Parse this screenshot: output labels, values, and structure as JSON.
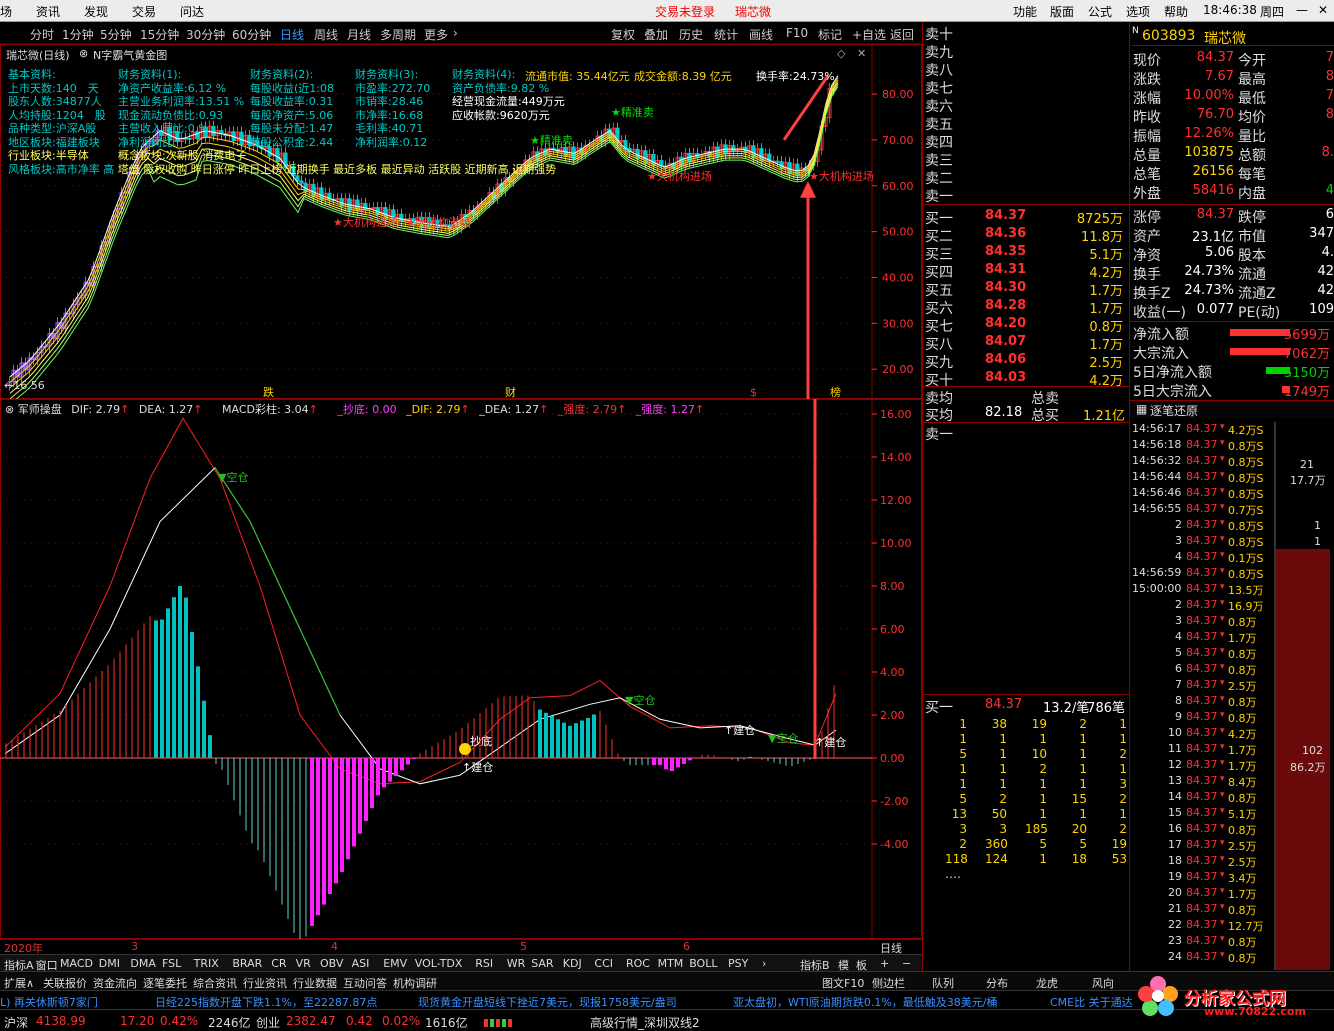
{
  "menubar": {
    "items": [
      "场",
      "资讯",
      "发现",
      "交易",
      "问达"
    ],
    "center_left": "交易未登录",
    "center_right": "瑞芯微",
    "right_items": [
      "功能",
      "版面",
      "公式",
      "选项",
      "帮助"
    ],
    "time": "18:46:38",
    "weekday": "周四"
  },
  "toolbar": {
    "periods": [
      "分时",
      "1分钟",
      "5分钟",
      "15分钟",
      "30分钟",
      "60分钟",
      "日线",
      "周线",
      "月线",
      "多周期",
      "更多"
    ],
    "active": "日线",
    "tools": [
      "复权",
      "叠加",
      "历史",
      "统计",
      "画线",
      "F10",
      "标记",
      "+自选",
      "返回"
    ]
  },
  "kchart": {
    "title": "瑞芯微(日线)",
    "formula": "N字霸气黄金图",
    "y_ticks": [
      "80.00",
      "70.00",
      "60.00",
      "50.00",
      "40.00",
      "30.00",
      "20.00"
    ],
    "low_mark": "16.56",
    "info": {
      "col1": [
        "基本资料:",
        "上市天数:140　天",
        "股东人数:34877人",
        "人均持股:1204　股",
        "品种类型:沪深A股",
        "地区板块:福建板块",
        "行业板块:半导体",
        "风格板块:高市净率 高"
      ],
      "col2": [
        "财务资料(1):",
        "净资产收益率:6.12 %",
        "主营业务利润率:13.51 %",
        "现金流动负债比:0.93",
        "主营收入同比:0.%",
        "净利润同比:",
        "概念板块:次新股 消费电子"
      ],
      "col3": [
        "财务资料(2):",
        "每股收益(近1:08",
        "每股收益率:0.31",
        "每股净资产:5.06",
        "每股未分配:1.47",
        "每股公积金:2.44"
      ],
      "col4": [
        "财务资料(3):",
        "市盈率:272.70",
        "市销率:28.46",
        "市净率:16.68",
        "毛利率:40.71",
        "净利润率:0.12"
      ],
      "col5": [
        "财务资料(4):",
        "资产负债率:9.82 %",
        "经营现金流量:449万元",
        "应收帐款:9620万元"
      ],
      "market_value": "流通市值: 35.44亿元",
      "turnover_amt": "成交金额:8.39 亿元",
      "turnover_rate": "换手率:24.73%",
      "style_tail": "塔值 股权收购 昨日涨停 昨日上榜 近期换手 最近多板 最近异动 活跃股 近期新高 近期强势"
    },
    "labels": {
      "accurate_sell": "精准卖",
      "accurate_sell2": "精准卖",
      "inst1": "大机构进场",
      "inst2": "大机构进场",
      "inst3": "大机构进场",
      "inst4": "大机构进场"
    },
    "events": [
      "跌",
      "财",
      "$",
      "榜"
    ]
  },
  "macd": {
    "title": "军师操盘",
    "dif": "DIF: 2.79",
    "dea": "DEA: 1.27",
    "bar": "MACD彩柱: 3.04",
    "chaodi": "_抄底: 0.00",
    "dif2": "_DIF: 2.79",
    "dea2": "_DEA: 1.27",
    "strong": "_强度: 2.79",
    "strong2": "_强度: 1.27",
    "y_ticks": [
      "16.00",
      "14.00",
      "12.00",
      "10.00",
      "8.00",
      "6.00",
      "4.00",
      "2.00",
      "0.00",
      "-2.00",
      "-4.00"
    ],
    "labels": {
      "kongcang": "空仓",
      "chaodi": "抄底",
      "jiancang": "建仓"
    }
  },
  "dates": [
    "2020年",
    "3",
    "4",
    "5",
    "6"
  ],
  "indicator_tabs": [
    "指标A",
    "窗口",
    "MACD",
    "DMI",
    "DMA",
    "FSL",
    "TRIX",
    "BRAR",
    "CR",
    "VR",
    "OBV",
    "ASI",
    "EMV",
    "VOL-TDX",
    "RSI",
    "WR",
    "SAR",
    "KDJ",
    "CCI",
    "ROC",
    "MTM",
    "BOLL",
    "PSY"
  ],
  "indicator_right": [
    "指标B",
    "模",
    "板"
  ],
  "bottom_tabs": [
    "扩展∧",
    "关联报价",
    "资金流向",
    "逐笔委托",
    "综合资讯",
    "行业资讯",
    "行业数据",
    "互动问答",
    "机构调研"
  ],
  "bottom_right": [
    "图文F10",
    "侧边栏",
    "队列",
    "分布",
    "龙虎",
    "板块",
    "风向"
  ],
  "orderbook": {
    "sell_labels": [
      "卖十",
      "卖九",
      "卖八",
      "卖七",
      "卖六",
      "卖五",
      "卖四",
      "卖三",
      "卖二",
      "卖一"
    ],
    "buys": [
      [
        "买一",
        "84.37",
        "8725万"
      ],
      [
        "买二",
        "84.36",
        "11.8万"
      ],
      [
        "买三",
        "84.35",
        "5.1万"
      ],
      [
        "买四",
        "84.31",
        "4.2万"
      ],
      [
        "买五",
        "84.30",
        "1.7万"
      ],
      [
        "买六",
        "84.28",
        "1.7万"
      ],
      [
        "买七",
        "84.20",
        "0.8万"
      ],
      [
        "买八",
        "84.07",
        "1.7万"
      ],
      [
        "买九",
        "84.06",
        "2.5万"
      ],
      [
        "买十",
        "84.03",
        "4.2万"
      ]
    ],
    "avg_sell": "卖均",
    "avg_buy": "买均",
    "avg_buy_price": "82.18",
    "total_sell": "总卖",
    "total_buy": "总买",
    "total_buy_val": "1.21亿",
    "sell1": "卖一",
    "queue_head": [
      "买一",
      "84.37",
      "13.2/笔",
      "786笔"
    ],
    "queue": [
      [
        "1",
        "38",
        "19",
        "2",
        "1"
      ],
      [
        "1",
        "1",
        "1",
        "1",
        "1"
      ],
      [
        "5",
        "1",
        "10",
        "1",
        "2"
      ],
      [
        "1",
        "1",
        "2",
        "1",
        "1"
      ],
      [
        "1",
        "1",
        "1",
        "1",
        "3"
      ],
      [
        "5",
        "2",
        "1",
        "15",
        "2"
      ],
      [
        "13",
        "50",
        "1",
        "1",
        "1"
      ],
      [
        "3",
        "3",
        "185",
        "20",
        "2"
      ],
      [
        "2",
        "360",
        "5",
        "5",
        "19"
      ],
      [
        "118",
        "124",
        "1",
        "18",
        "53"
      ]
    ],
    "more": "…."
  },
  "quote": {
    "code": "603893",
    "name": "瑞芯微",
    "rows": [
      [
        "现价",
        "84.37",
        "今开",
        "7"
      ],
      [
        "涨跌",
        "7.67",
        "最高",
        "8"
      ],
      [
        "涨幅",
        "10.00%",
        "最低",
        "7"
      ],
      [
        "昨收",
        "76.70",
        "均价",
        "8"
      ],
      [
        "振幅",
        "12.26%",
        "量比",
        ""
      ],
      [
        "总量",
        "103875",
        "总额",
        "8."
      ],
      [
        "总笔",
        "26156",
        "每笔",
        ""
      ],
      [
        "外盘",
        "58416",
        "内盘",
        "4"
      ]
    ],
    "rows2": [
      [
        "涨停",
        "84.37",
        "跌停",
        "6"
      ],
      [
        "资产",
        "23.1亿",
        "市值",
        "347"
      ],
      [
        "净资",
        "5.06",
        "股本",
        "4."
      ],
      [
        "换手",
        "24.73%",
        "流通",
        "42"
      ],
      [
        "换手Z",
        "24.73%",
        "流通Z",
        "42"
      ],
      [
        "收益(一)",
        "0.077",
        "PE(动)",
        "109"
      ]
    ],
    "flows": [
      [
        "净流入额",
        "5699万"
      ],
      [
        "大宗流入",
        "7062万"
      ],
      [
        "5日净流入额",
        "-5150万"
      ],
      [
        "5日大宗流入",
        "1749万"
      ]
    ]
  },
  "ticks": {
    "title": "逐笔还原",
    "rows": [
      [
        "14:56:17",
        "84.37",
        "4.2万S"
      ],
      [
        "14:56:18",
        "84.37",
        "0.8万S"
      ],
      [
        "14:56:32",
        "84.37",
        "0.8万S"
      ],
      [
        "14:56:44",
        "84.37",
        "0.8万S"
      ],
      [
        "14:56:46",
        "84.37",
        "0.8万S"
      ],
      [
        "14:56:55",
        "84.37",
        "0.7万S"
      ],
      [
        "2",
        "84.37",
        "0.8万S"
      ],
      [
        "3",
        "84.37",
        "0.8万S"
      ],
      [
        "4",
        "84.37",
        "0.1万S"
      ],
      [
        "14:56:59",
        "84.37",
        "0.8万S"
      ],
      [
        "15:00:00",
        "84.37",
        "13.5万"
      ],
      [
        "2",
        "84.37",
        "16.9万"
      ],
      [
        "3",
        "84.37",
        "0.8万"
      ],
      [
        "4",
        "84.37",
        "1.7万"
      ],
      [
        "5",
        "84.37",
        "0.8万"
      ],
      [
        "6",
        "84.37",
        "0.8万"
      ],
      [
        "7",
        "84.37",
        "2.5万"
      ],
      [
        "8",
        "84.37",
        "0.8万"
      ],
      [
        "9",
        "84.37",
        "0.8万"
      ],
      [
        "10",
        "84.37",
        "4.2万"
      ],
      [
        "11",
        "84.37",
        "1.7万"
      ],
      [
        "12",
        "84.37",
        "1.7万"
      ],
      [
        "13",
        "84.37",
        "8.4万"
      ],
      [
        "14",
        "84.37",
        "0.8万"
      ],
      [
        "15",
        "84.37",
        "5.1万"
      ],
      [
        "16",
        "84.37",
        "0.8万"
      ],
      [
        "17",
        "84.37",
        "2.5万"
      ],
      [
        "18",
        "84.37",
        "2.5万"
      ],
      [
        "19",
        "84.37",
        "3.4万"
      ],
      [
        "20",
        "84.37",
        "1.7万"
      ],
      [
        "21",
        "84.37",
        "0.8万"
      ],
      [
        "22",
        "84.37",
        "12.7万"
      ],
      [
        "23",
        "84.37",
        "0.8万"
      ],
      [
        "24",
        "84.37",
        "0.8万"
      ]
    ],
    "side": [
      "21",
      "17.7万",
      "1",
      "1",
      "102",
      "86.2万"
    ]
  },
  "ticker": {
    "items": [
      "L) 再关休斯顿7家门",
      "日经225指数开盘下跌1.1%，至22287.87点",
      "现货黄金开盘短线下挫近7美元，现报1758美元/盎司",
      "亚太盘初，WTI原油期货跌0.1%，最低触及38美元/桶",
      "CME比 关于通达"
    ]
  },
  "status": {
    "sh_label": "沪深",
    "sh": "4138.99",
    "sh_chg": "17.20",
    "sh_pct": "0.42%",
    "sh_amt": "2246亿",
    "cy_label": "创业",
    "cy": "2382.47",
    "cy_chg": "0.42",
    "cy_pct": "0.02%",
    "cy_amt": "1616亿",
    "feed": "高级行情_深圳双线2"
  },
  "watermark": {
    "line1": "分析家公式网",
    "line2": "www.70822.com"
  }
}
